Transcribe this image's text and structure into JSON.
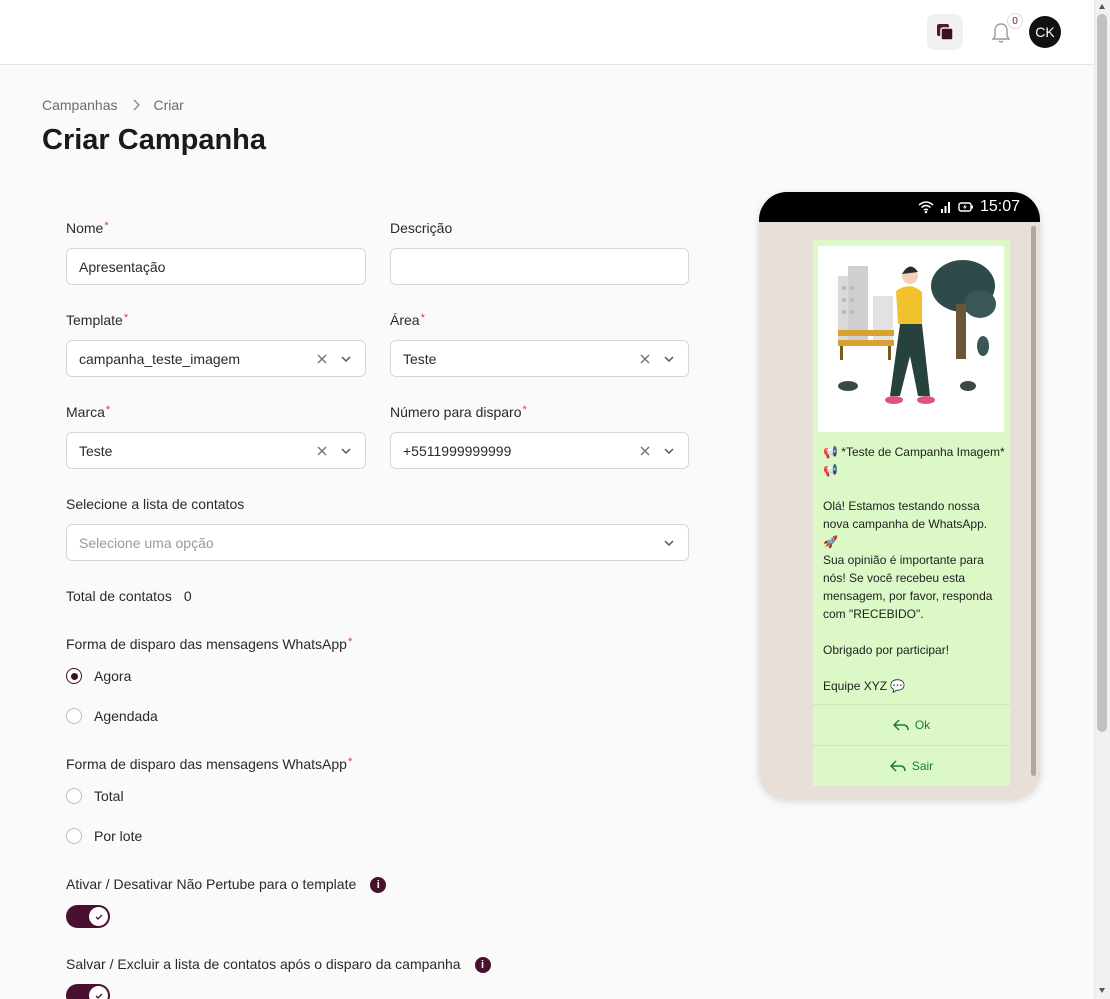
{
  "header": {
    "notifications_count": "0",
    "avatar_initials": "CK"
  },
  "breadcrumb": {
    "parent": "Campanhas",
    "current": "Criar"
  },
  "page_title": "Criar Campanha",
  "form": {
    "nome": {
      "label": "Nome",
      "value": "Apresentação"
    },
    "descricao": {
      "label": "Descrição",
      "value": ""
    },
    "template": {
      "label": "Template",
      "value": "campanha_teste_imagem"
    },
    "area": {
      "label": "Área",
      "value": "Teste"
    },
    "marca": {
      "label": "Marca",
      "value": "Teste"
    },
    "numero": {
      "label": "Número para disparo",
      "value": "+5511999999999"
    },
    "lista": {
      "label": "Selecione a lista de contatos",
      "placeholder": "Selecione uma opção"
    },
    "total": {
      "label": "Total de contatos",
      "value": "0"
    },
    "forma1": {
      "label": "Forma de disparo das mensagens WhatsApp",
      "options": [
        "Agora",
        "Agendada"
      ],
      "selected": "Agora"
    },
    "forma2": {
      "label": "Forma de disparo das mensagens WhatsApp",
      "options": [
        "Total",
        "Por lote"
      ],
      "selected": ""
    },
    "nao_perturbe": {
      "label": "Ativar / Desativar Não Pertube para o template",
      "enabled": true
    },
    "salvar_lista": {
      "label": "Salvar / Excluir a lista de contatos após o disparo da campanha",
      "enabled": true
    }
  },
  "phone": {
    "time": "15:07",
    "message_text": "📢 *Teste de Campanha Imagem* 📢\n\nOlá! Estamos testando nossa nova campanha de WhatsApp. 🚀\nSua opinião é importante para nós! Se você recebeu esta mensagem, por favor, responda com \"RECEBIDO\".\n\nObrigado por participar!\n\nEquipe XYZ 💬",
    "buttons": [
      "Ok",
      "Sair"
    ]
  },
  "colors": {
    "accent": "#4a1030",
    "bubble": "#dcf8c6",
    "chat_bg": "#e8e0d8",
    "required": "#e53935"
  }
}
